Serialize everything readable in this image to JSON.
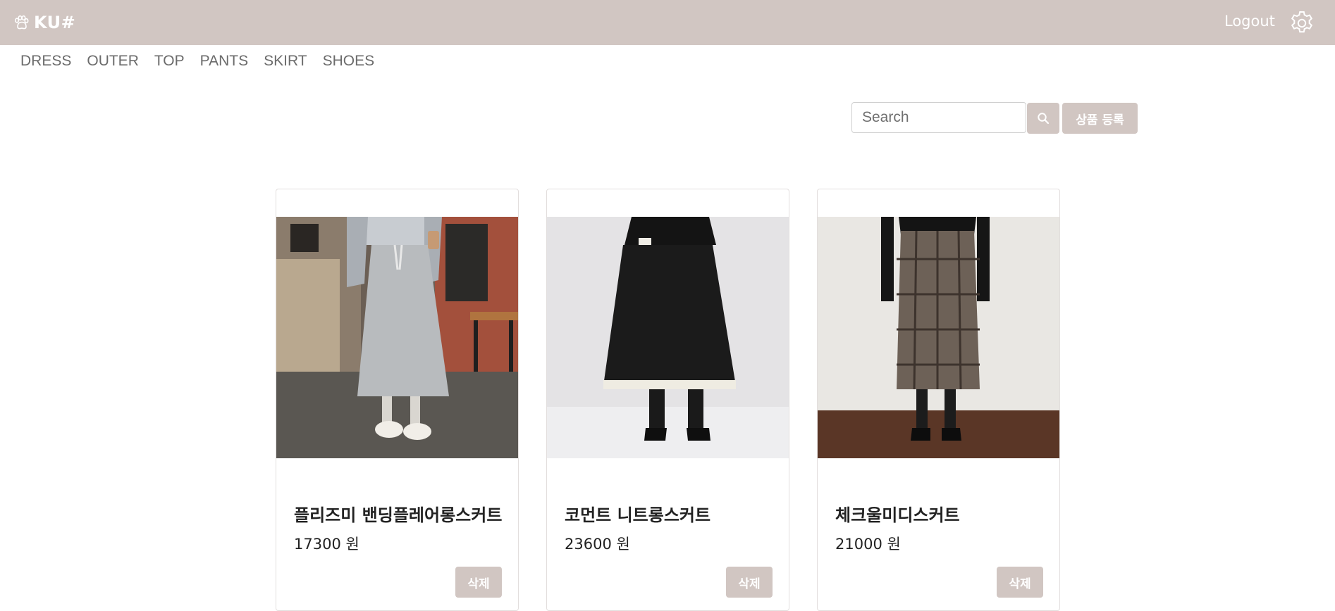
{
  "header": {
    "brand": "KU#",
    "brand_icon": "paw-icon",
    "logout_label": "Logout",
    "settings_icon": "gear-icon",
    "background_color": "#d1c6c2"
  },
  "categories": [
    "DRESS",
    "OUTER",
    "TOP",
    "PANTS",
    "SKIRT",
    "SHOES"
  ],
  "search": {
    "placeholder": "Search",
    "value": "",
    "button_icon": "search-icon"
  },
  "register_button_label": "상품 등록",
  "products": [
    {
      "name": "플리즈미 밴딩플레어롱스커트",
      "price": "17300 원",
      "delete_label": "삭제",
      "image": "gray-long-skirt-photo"
    },
    {
      "name": "코먼트 니트롱스커트",
      "price": "23600 원",
      "delete_label": "삭제",
      "image": "black-knit-skirt-photo"
    },
    {
      "name": "체크울미디스커트",
      "price": "21000 원",
      "delete_label": "삭제",
      "image": "check-wool-midi-skirt-photo"
    }
  ]
}
